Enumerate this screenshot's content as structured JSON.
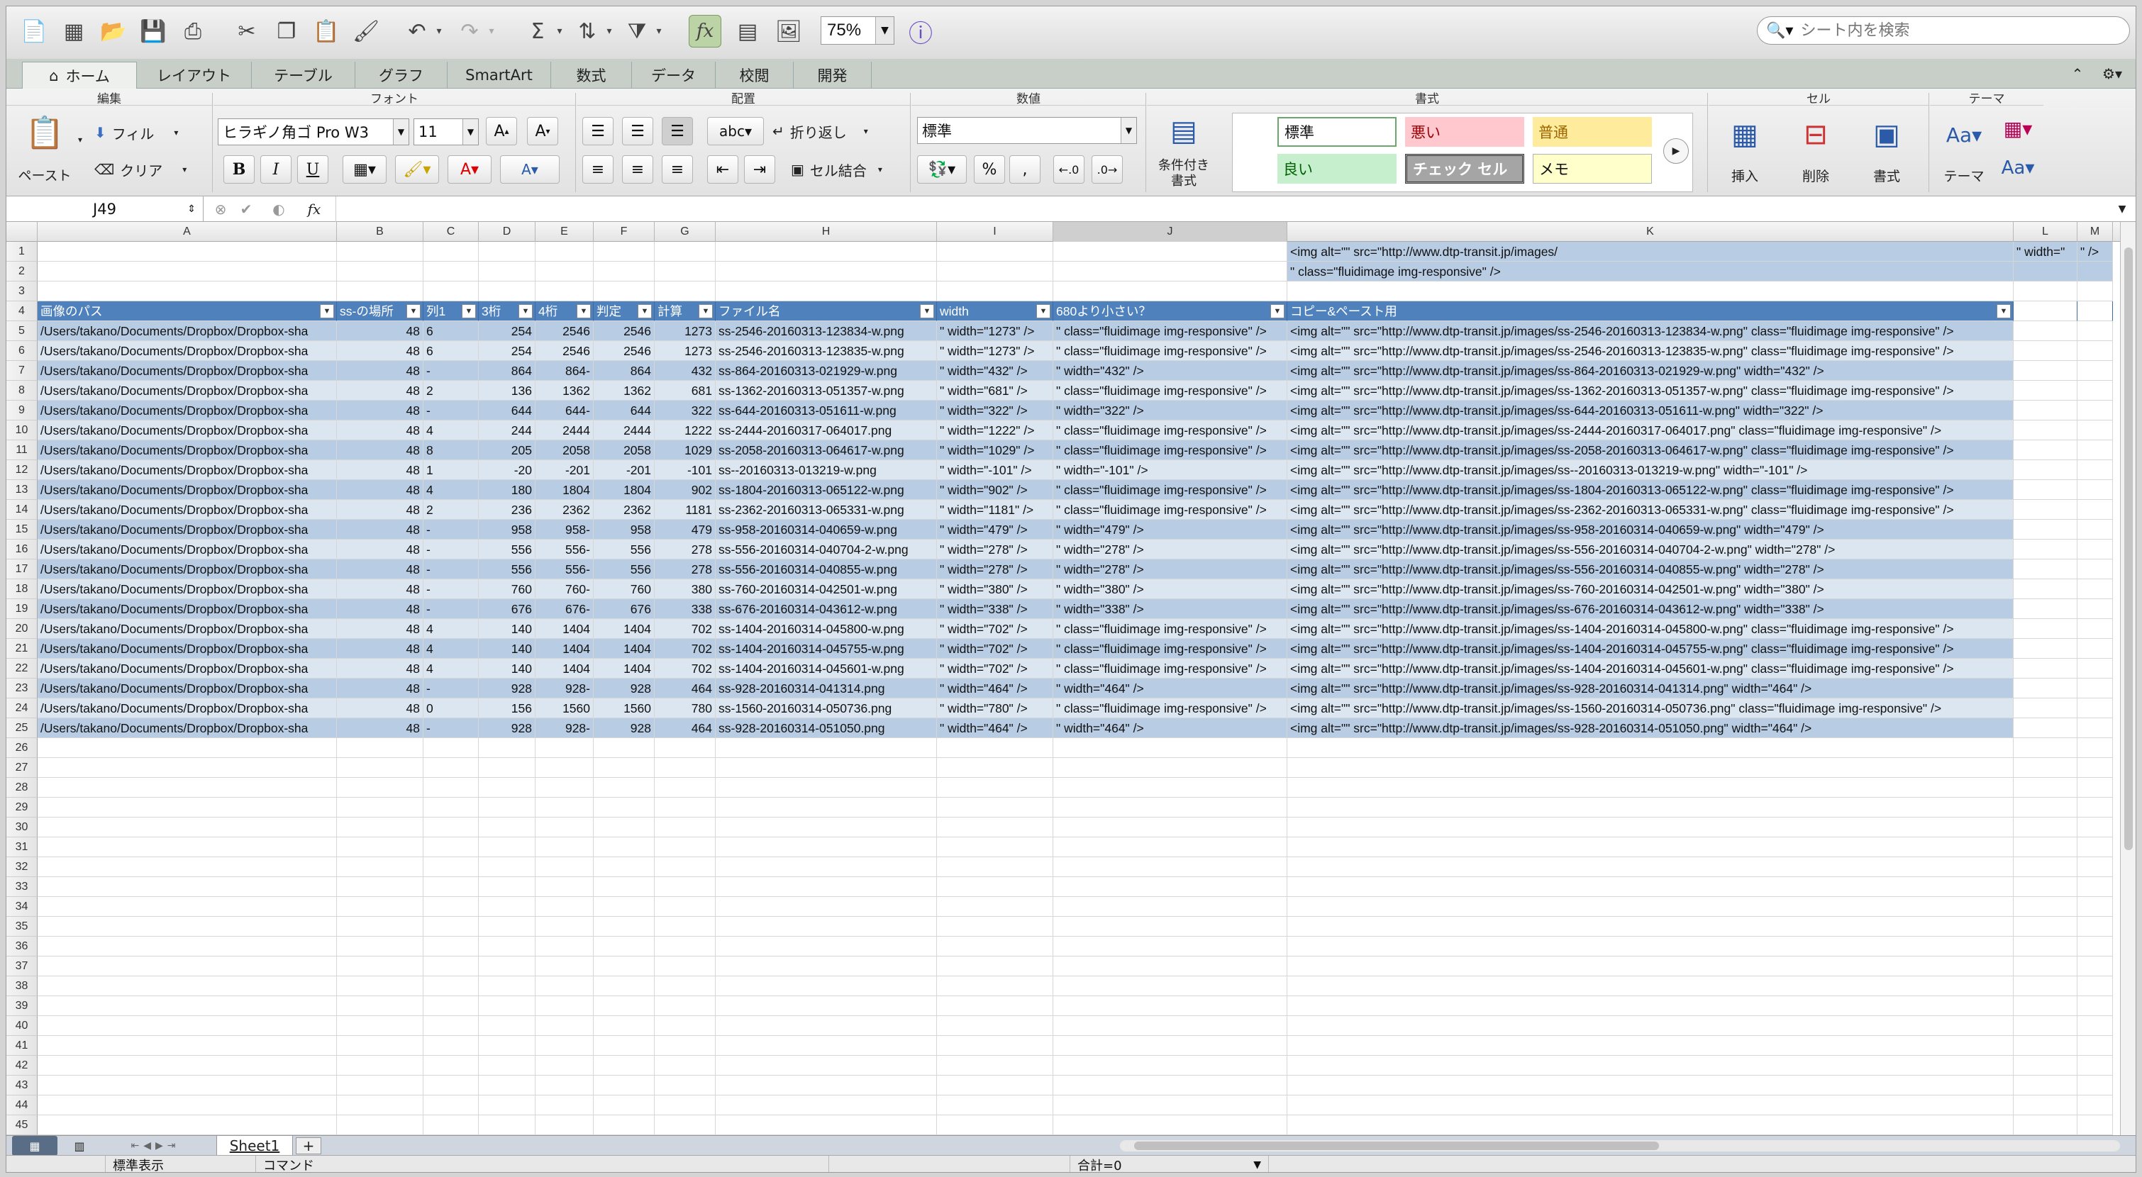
{
  "toolbar": {
    "zoom": "75%",
    "search_placeholder": "シート内を検索"
  },
  "tabs": [
    "ホーム",
    "レイアウト",
    "テーブル",
    "グラフ",
    "SmartArt",
    "数式",
    "データ",
    "校閲",
    "開発"
  ],
  "ribbon": {
    "groups": {
      "edit": "編集",
      "font": "フォント",
      "align": "配置",
      "number": "数値",
      "format": "書式",
      "cells": "セル",
      "theme": "テーマ"
    },
    "paste": "ペースト",
    "fill": "フィル",
    "clear": "クリア",
    "font_name": "ヒラギノ角ゴ Pro W3",
    "font_size": "11",
    "wrap": "折り返し",
    "merge": "セル結合",
    "abc": "abc",
    "number_format": "標準",
    "cond_format": "条件付き\n書式",
    "styles": {
      "normal": "標準",
      "bad": "悪い",
      "neutral": "普通",
      "good": "良い",
      "check": "チェック セル",
      "memo": "メモ"
    },
    "insert": "挿入",
    "delete": "削除",
    "format": "書式",
    "theme": "テーマ"
  },
  "formula": {
    "cell": "J49",
    "fx": "fx",
    "value": ""
  },
  "columns": [
    "A",
    "B",
    "C",
    "D",
    "E",
    "F",
    "G",
    "H",
    "I",
    "J",
    "K",
    "L",
    "M"
  ],
  "top_rows": {
    "r1": {
      "K": "<img alt=\"\" src=\"http://www.dtp-transit.jp/images/",
      "L": "\" width=\"",
      "M": "\" />"
    },
    "r2": {
      "K": "\" class=\"fluidimage img-responsive\" />"
    }
  },
  "headers": [
    "画像のパス",
    "ss-の場所",
    "列1",
    "3桁",
    "4桁",
    "判定",
    "計算",
    "ファイル名",
    "width",
    "680より小さい？",
    "コピー&ペースト用"
  ],
  "table_rows": [
    [
      "/Users/takano/Documents/Dropbox/Dropbox-sha",
      "48",
      "6",
      "254",
      "2546",
      "2546",
      "1273",
      "ss-2546-20160313-123834-w.png",
      "\" width=\"1273\" />",
      "\" class=\"fluidimage img-responsive\" />",
      "<img alt=\"\" src=\"http://www.dtp-transit.jp/images/ss-2546-20160313-123834-w.png\" class=\"fluidimage img-responsive\" />"
    ],
    [
      "/Users/takano/Documents/Dropbox/Dropbox-sha",
      "48",
      "6",
      "254",
      "2546",
      "2546",
      "1273",
      "ss-2546-20160313-123835-w.png",
      "\" width=\"1273\" />",
      "\" class=\"fluidimage img-responsive\" />",
      "<img alt=\"\" src=\"http://www.dtp-transit.jp/images/ss-2546-20160313-123835-w.png\" class=\"fluidimage img-responsive\" />"
    ],
    [
      "/Users/takano/Documents/Dropbox/Dropbox-sha",
      "48",
      "-",
      "864",
      "864-",
      "864",
      "432",
      "ss-864-20160313-021929-w.png",
      "\" width=\"432\" />",
      "\" width=\"432\" />",
      "<img alt=\"\" src=\"http://www.dtp-transit.jp/images/ss-864-20160313-021929-w.png\" width=\"432\" />"
    ],
    [
      "/Users/takano/Documents/Dropbox/Dropbox-sha",
      "48",
      "2",
      "136",
      "1362",
      "1362",
      "681",
      "ss-1362-20160313-051357-w.png",
      "\" width=\"681\" />",
      "\" class=\"fluidimage img-responsive\" />",
      "<img alt=\"\" src=\"http://www.dtp-transit.jp/images/ss-1362-20160313-051357-w.png\" class=\"fluidimage img-responsive\" />"
    ],
    [
      "/Users/takano/Documents/Dropbox/Dropbox-sha",
      "48",
      "-",
      "644",
      "644-",
      "644",
      "322",
      "ss-644-20160313-051611-w.png",
      "\" width=\"322\" />",
      "\" width=\"322\" />",
      "<img alt=\"\" src=\"http://www.dtp-transit.jp/images/ss-644-20160313-051611-w.png\" width=\"322\" />"
    ],
    [
      "/Users/takano/Documents/Dropbox/Dropbox-sha",
      "48",
      "4",
      "244",
      "2444",
      "2444",
      "1222",
      "ss-2444-20160317-064017.png",
      "\" width=\"1222\" />",
      "\" class=\"fluidimage img-responsive\" />",
      "<img alt=\"\" src=\"http://www.dtp-transit.jp/images/ss-2444-20160317-064017.png\" class=\"fluidimage img-responsive\" />"
    ],
    [
      "/Users/takano/Documents/Dropbox/Dropbox-sha",
      "48",
      "8",
      "205",
      "2058",
      "2058",
      "1029",
      "ss-2058-20160313-064617-w.png",
      "\" width=\"1029\" />",
      "\" class=\"fluidimage img-responsive\" />",
      "<img alt=\"\" src=\"http://www.dtp-transit.jp/images/ss-2058-20160313-064617-w.png\" class=\"fluidimage img-responsive\" />"
    ],
    [
      "/Users/takano/Documents/Dropbox/Dropbox-sha",
      "48",
      "1",
      "-20",
      "-201",
      "-201",
      "-101",
      "ss--20160313-013219-w.png",
      "\" width=\"-101\" />",
      "\" width=\"-101\" />",
      "<img alt=\"\" src=\"http://www.dtp-transit.jp/images/ss--20160313-013219-w.png\" width=\"-101\" />"
    ],
    [
      "/Users/takano/Documents/Dropbox/Dropbox-sha",
      "48",
      "4",
      "180",
      "1804",
      "1804",
      "902",
      "ss-1804-20160313-065122-w.png",
      "\" width=\"902\" />",
      "\" class=\"fluidimage img-responsive\" />",
      "<img alt=\"\" src=\"http://www.dtp-transit.jp/images/ss-1804-20160313-065122-w.png\" class=\"fluidimage img-responsive\" />"
    ],
    [
      "/Users/takano/Documents/Dropbox/Dropbox-sha",
      "48",
      "2",
      "236",
      "2362",
      "2362",
      "1181",
      "ss-2362-20160313-065331-w.png",
      "\" width=\"1181\" />",
      "\" class=\"fluidimage img-responsive\" />",
      "<img alt=\"\" src=\"http://www.dtp-transit.jp/images/ss-2362-20160313-065331-w.png\" class=\"fluidimage img-responsive\" />"
    ],
    [
      "/Users/takano/Documents/Dropbox/Dropbox-sha",
      "48",
      "-",
      "958",
      "958-",
      "958",
      "479",
      "ss-958-20160314-040659-w.png",
      "\" width=\"479\" />",
      "\" width=\"479\" />",
      "<img alt=\"\" src=\"http://www.dtp-transit.jp/images/ss-958-20160314-040659-w.png\" width=\"479\" />"
    ],
    [
      "/Users/takano/Documents/Dropbox/Dropbox-sha",
      "48",
      "-",
      "556",
      "556-",
      "556",
      "278",
      "ss-556-20160314-040704-2-w.png",
      "\" width=\"278\" />",
      "\" width=\"278\" />",
      "<img alt=\"\" src=\"http://www.dtp-transit.jp/images/ss-556-20160314-040704-2-w.png\" width=\"278\" />"
    ],
    [
      "/Users/takano/Documents/Dropbox/Dropbox-sha",
      "48",
      "-",
      "556",
      "556-",
      "556",
      "278",
      "ss-556-20160314-040855-w.png",
      "\" width=\"278\" />",
      "\" width=\"278\" />",
      "<img alt=\"\" src=\"http://www.dtp-transit.jp/images/ss-556-20160314-040855-w.png\" width=\"278\" />"
    ],
    [
      "/Users/takano/Documents/Dropbox/Dropbox-sha",
      "48",
      "-",
      "760",
      "760-",
      "760",
      "380",
      "ss-760-20160314-042501-w.png",
      "\" width=\"380\" />",
      "\" width=\"380\" />",
      "<img alt=\"\" src=\"http://www.dtp-transit.jp/images/ss-760-20160314-042501-w.png\" width=\"380\" />"
    ],
    [
      "/Users/takano/Documents/Dropbox/Dropbox-sha",
      "48",
      "-",
      "676",
      "676-",
      "676",
      "338",
      "ss-676-20160314-043612-w.png",
      "\" width=\"338\" />",
      "\" width=\"338\" />",
      "<img alt=\"\" src=\"http://www.dtp-transit.jp/images/ss-676-20160314-043612-w.png\" width=\"338\" />"
    ],
    [
      "/Users/takano/Documents/Dropbox/Dropbox-sha",
      "48",
      "4",
      "140",
      "1404",
      "1404",
      "702",
      "ss-1404-20160314-045800-w.png",
      "\" width=\"702\" />",
      "\" class=\"fluidimage img-responsive\" />",
      "<img alt=\"\" src=\"http://www.dtp-transit.jp/images/ss-1404-20160314-045800-w.png\" class=\"fluidimage img-responsive\" />"
    ],
    [
      "/Users/takano/Documents/Dropbox/Dropbox-sha",
      "48",
      "4",
      "140",
      "1404",
      "1404",
      "702",
      "ss-1404-20160314-045755-w.png",
      "\" width=\"702\" />",
      "\" class=\"fluidimage img-responsive\" />",
      "<img alt=\"\" src=\"http://www.dtp-transit.jp/images/ss-1404-20160314-045755-w.png\" class=\"fluidimage img-responsive\" />"
    ],
    [
      "/Users/takano/Documents/Dropbox/Dropbox-sha",
      "48",
      "4",
      "140",
      "1404",
      "1404",
      "702",
      "ss-1404-20160314-045601-w.png",
      "\" width=\"702\" />",
      "\" class=\"fluidimage img-responsive\" />",
      "<img alt=\"\" src=\"http://www.dtp-transit.jp/images/ss-1404-20160314-045601-w.png\" class=\"fluidimage img-responsive\" />"
    ],
    [
      "/Users/takano/Documents/Dropbox/Dropbox-sha",
      "48",
      "-",
      "928",
      "928-",
      "928",
      "464",
      "ss-928-20160314-041314.png",
      "\" width=\"464\" />",
      "\" width=\"464\" />",
      "<img alt=\"\" src=\"http://www.dtp-transit.jp/images/ss-928-20160314-041314.png\" width=\"464\" />"
    ],
    [
      "/Users/takano/Documents/Dropbox/Dropbox-sha",
      "48",
      "0",
      "156",
      "1560",
      "1560",
      "780",
      "ss-1560-20160314-050736.png",
      "\" width=\"780\" />",
      "\" class=\"fluidimage img-responsive\" />",
      "<img alt=\"\" src=\"http://www.dtp-transit.jp/images/ss-1560-20160314-050736.png\" class=\"fluidimage img-responsive\" />"
    ],
    [
      "/Users/takano/Documents/Dropbox/Dropbox-sha",
      "48",
      "-",
      "928",
      "928-",
      "928",
      "464",
      "ss-928-20160314-051050.png",
      "\" width=\"464\" />",
      "\" width=\"464\" />",
      "<img alt=\"\" src=\"http://www.dtp-transit.jp/images/ss-928-20160314-051050.png\" width=\"464\" />"
    ]
  ],
  "row_numbers": [
    1,
    2,
    3,
    4,
    5,
    6,
    7,
    8,
    9,
    10,
    11,
    12,
    13,
    14,
    15,
    16,
    17,
    18,
    19,
    20,
    21,
    22,
    23,
    24,
    25,
    26,
    27,
    28,
    29,
    30,
    31,
    32,
    33,
    34,
    35,
    36,
    37,
    38,
    39,
    40,
    41,
    42,
    43,
    44,
    45
  ],
  "sheet_tab": "Sheet1",
  "status": {
    "view": "標準表示",
    "mode": "コマンド",
    "sum": "合計=0"
  }
}
